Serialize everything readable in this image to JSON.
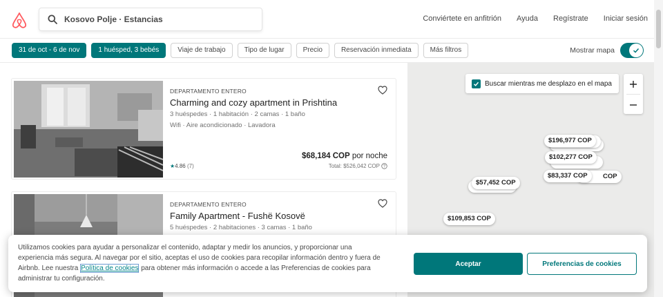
{
  "search": {
    "value": "Kosovo Polje · Estancias"
  },
  "nav": {
    "host": "Conviértete en anfitrión",
    "help": "Ayuda",
    "signup": "Regístrate",
    "login": "Iniciar sesión"
  },
  "filters": [
    {
      "label": "31 de oct - 6 de nov",
      "active": true
    },
    {
      "label": "1 huésped, 3 bebés",
      "active": true
    },
    {
      "label": "Viaje de trabajo"
    },
    {
      "label": "Tipo de lugar"
    },
    {
      "label": "Precio"
    },
    {
      "label": "Reservación inmediata"
    },
    {
      "label": "Más filtros"
    }
  ],
  "show_map": {
    "label": "Mostrar mapa",
    "on": true
  },
  "listings": [
    {
      "kind": "DEPARTAMENTO ENTERO",
      "title": "Charming and cozy apartment in Prishtina",
      "specs": "3 huéspedes · 1 habitación · 2 camas · 1 baño",
      "amenities": "Wifi · Aire acondicionado · Lavadora",
      "rating": "4.86",
      "reviews": "(7)",
      "price": "$68,184 COP",
      "price_unit": " por noche",
      "total": "Total: $526,042 COP"
    },
    {
      "kind": "DEPARTAMENTO ENTERO",
      "title": "Family Apartment - Fushë Kosovë",
      "specs": "5 huéspedes · 2 habitaciones · 3 camas · 1 baño"
    }
  ],
  "map": {
    "search_as_move": "Buscar mientras me desplazo en el mapa",
    "zoom_in": "+",
    "zoom_out": "−",
    "pins": [
      "$196,977 COP",
      "$102,277 COP",
      "$83,337 COP",
      "COP",
      "$57,452 COP",
      "$109,853 COP"
    ]
  },
  "cookie": {
    "text_before": "Utilizamos cookies para ayudar a personalizar el contenido, adaptar y medir los anuncios, y proporcionar una experiencia más segura. Al navegar por el sitio, aceptas el uso de cookies para recopilar información dentro y fuera de Airbnb. Lee nuestra ",
    "link": "Política de cookies",
    "text_after": " para obtener más información o accede a las Preferencias de cookies para administrar tu configuración.",
    "accept": "Aceptar",
    "preferences": "Preferencias de cookies"
  },
  "colors": {
    "brand": "#FF5A5F",
    "accent": "#00777A"
  }
}
